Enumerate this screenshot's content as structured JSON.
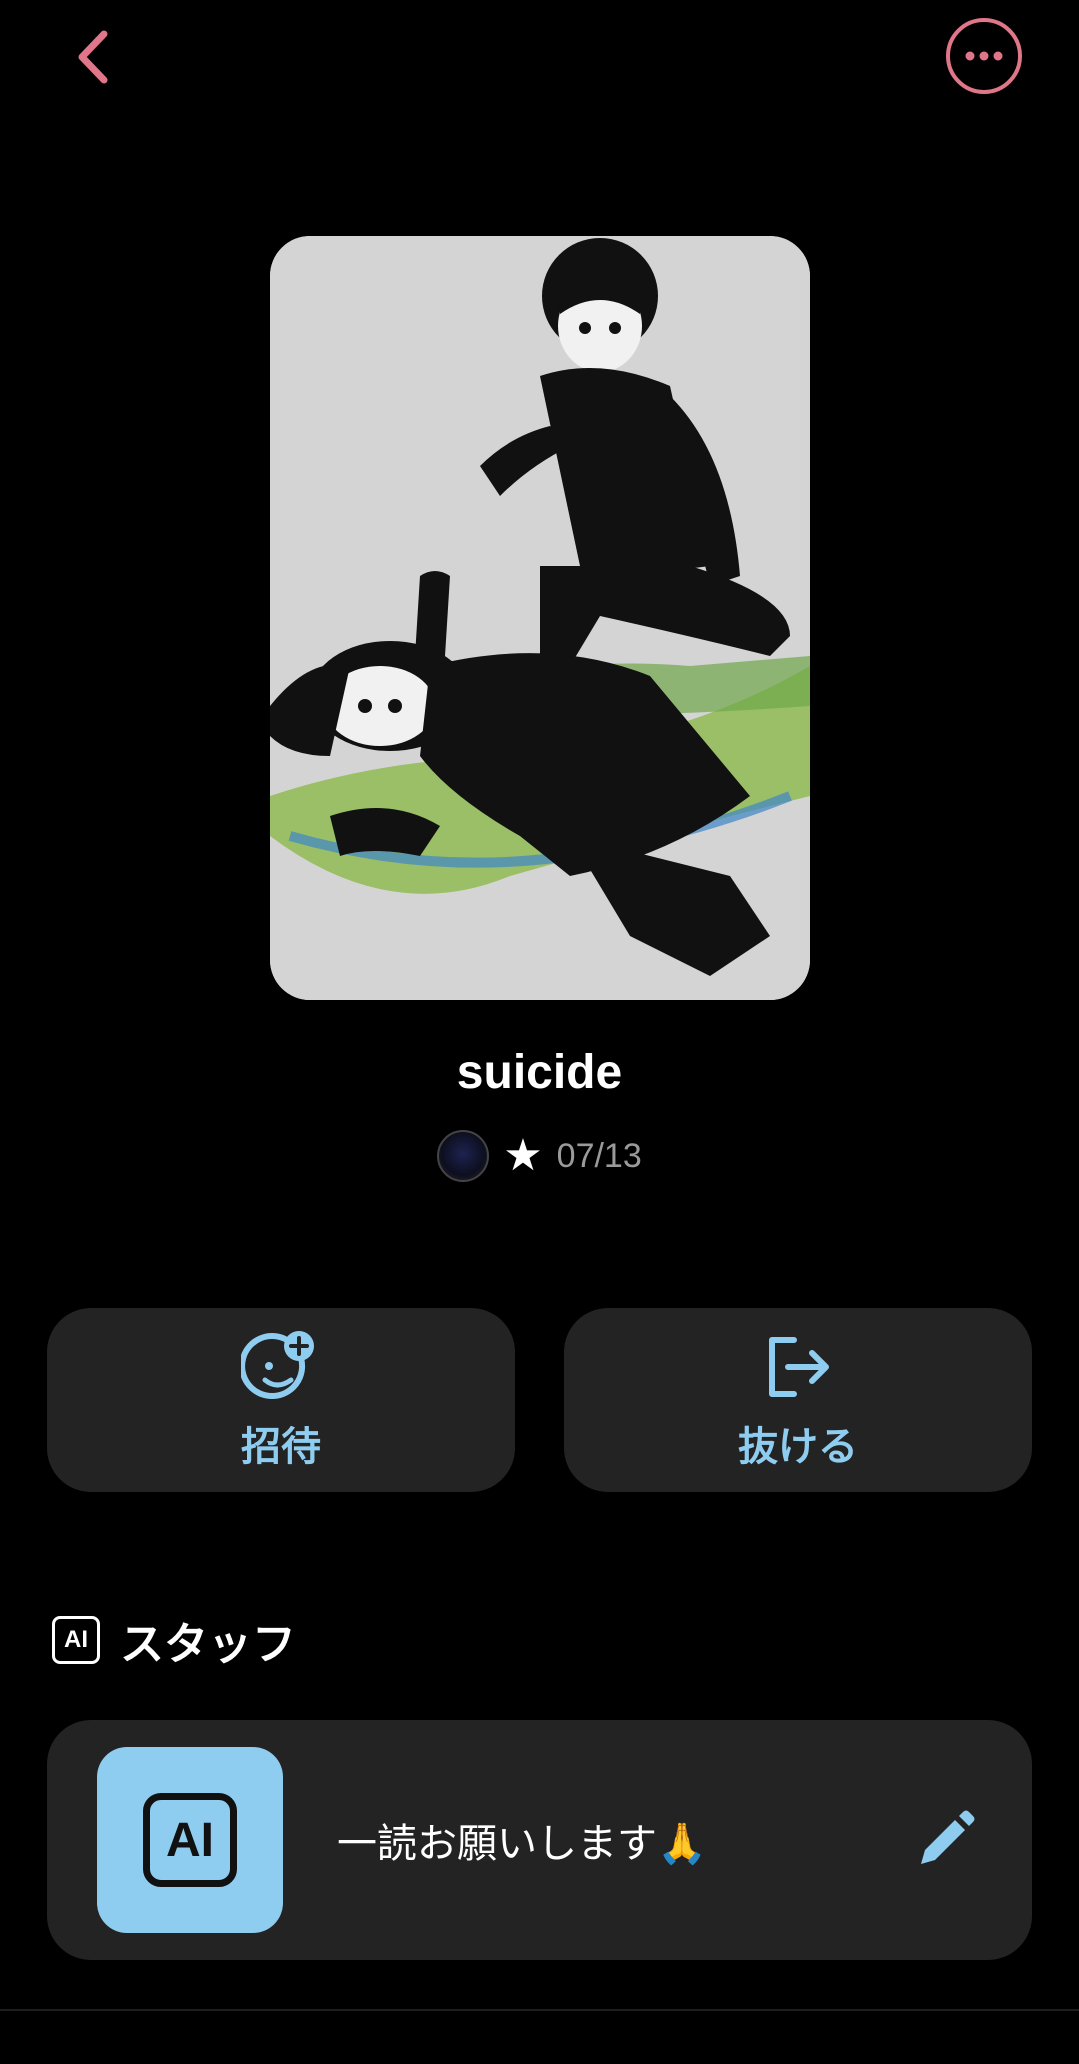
{
  "header": {
    "back_icon": "chevron-left-icon",
    "more_icon": "more-horizontal-icon",
    "accent_color": "#e0768a"
  },
  "room": {
    "title": "suicide",
    "star": "★",
    "date": "07/13"
  },
  "actions": {
    "invite_label": "招待",
    "leave_label": "抜ける"
  },
  "staff_section": {
    "badge": "AI",
    "title": "スタッフ",
    "item": {
      "avatar_badge": "AI",
      "message": "一読お願いします🙏"
    }
  },
  "colors": {
    "background": "#000000",
    "card": "#232323",
    "accent_blue": "#8fcdf0"
  }
}
